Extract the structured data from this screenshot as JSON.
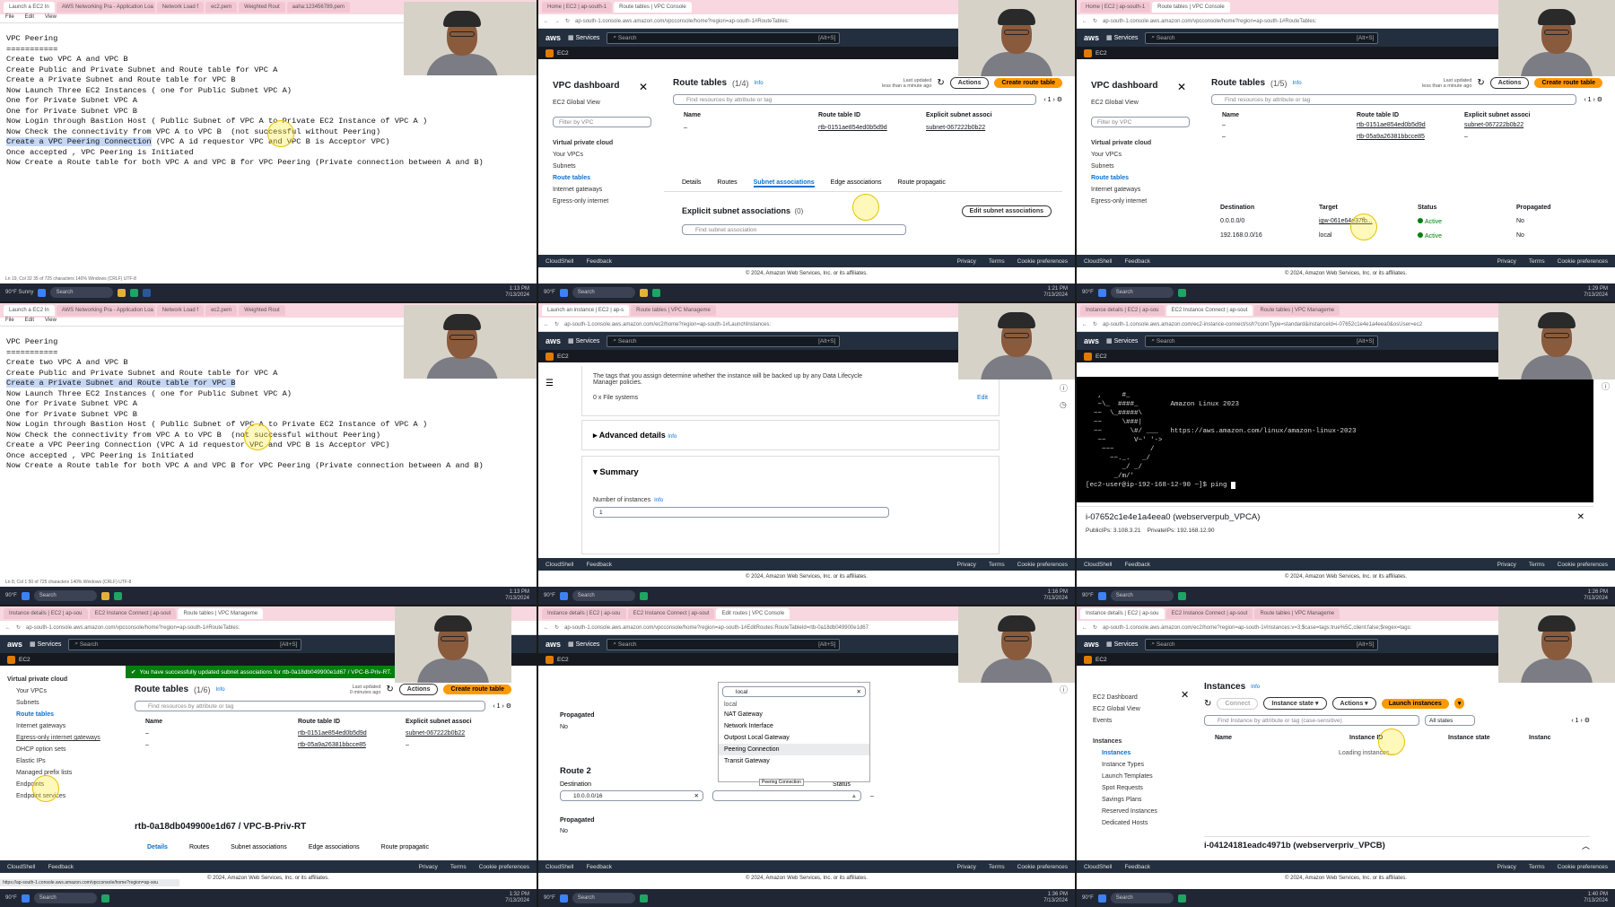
{
  "colors": {
    "aws_nav": "#232f3e",
    "aws_orange": "#ff9900",
    "aws_link": "#0972d3",
    "success": "#037f0c",
    "tab_bg": "#f8d7e0",
    "terminal": "#000000"
  },
  "common": {
    "aws_logo": "aws",
    "services": "Services",
    "search_placeholder": "Search",
    "search_shortcut": "[Alt+S]",
    "ec2": "EC2",
    "cloudshell": "CloudShell",
    "feedback": "Feedback",
    "copyright": "© 2024, Amazon Web Services, Inc. or its affiliates.",
    "privacy": "Privacy",
    "terms": "Terms",
    "cookie": "Cookie preferences",
    "temp": "90°F",
    "weather": "Sunny",
    "tb_search": "Search"
  },
  "p1": {
    "tabs": [
      "Launch a EC2 In",
      "AWS Networking Pra - Application Loa",
      "Network Load f",
      "ec2.pem",
      "Weighted Rout",
      "aaha:123456789.pem"
    ],
    "menu": [
      "File",
      "Edit",
      "View"
    ],
    "lines": [
      "VPC Peering",
      "===========",
      "",
      "Create two VPC A and VPC B",
      "",
      "Create Public and Private Subnet and Route table for VPC A",
      "",
      "Create a Private Subnet and Route table for VPC B",
      "",
      "Now Launch Three EC2 Instances ( one for Public Subnet VPC A)",
      "One for Private Subnet VPC A",
      "",
      "One for Private Subnet VPC B",
      "",
      "Now Login through Bastion Host ( Public Subnet of VPC A to Private EC2 Instance of VPC A )",
      "",
      "Now Check the connectivity from VPC A to VPC B  (not successful without Peering)",
      "",
      "Create a VPC Peering Connection (VPC A id requestor VPC and VPC B is Acceptor VPC)",
      "",
      "Once accepted , VPC Peering is Initiated",
      "",
      "Now Create a Route table for both VPC A and VPC B for VPC Peering (Private connection between A and B)"
    ],
    "highlight": "Create a VPC Peering Connection",
    "status": "Ln 19, Col 32    35 of 725 characters         140%    Windows (CRLF)    UTF-8",
    "time": "1:13 PM",
    "date": "7/13/2024"
  },
  "p2": {
    "tabs": [
      "Home | EC2 | ap-south-1",
      "Route tables | VPC Console"
    ],
    "url": "ap-south-1.console.aws.amazon.com/vpcconsole/home?region=ap-south-1#RouteTables:",
    "dash_title": "VPC dashboard",
    "global": "EC2 Global View",
    "filter": "Filter by VPC",
    "nav_head": "Virtual private cloud",
    "nav": [
      "Your VPCs",
      "Subnets",
      "Route tables",
      "Internet gateways",
      "Egress-only internet"
    ],
    "rt_title": "Route tables",
    "rt_count": "(1/4)",
    "info": "Info",
    "updated": "Last updated",
    "updated2": "less than a minute ago",
    "actions": "Actions",
    "create": "Create route table",
    "find": "Find resources by attribute or tag",
    "page": "1",
    "cols": [
      "Name",
      "Route table ID",
      "Explicit subnet associ"
    ],
    "row": [
      "–",
      "rtb-0151ae854ed0b5d9d",
      "subnet-067222b0b22"
    ],
    "dtabs": [
      "Details",
      "Routes",
      "Subnet associations",
      "Edge associations",
      "Route propagatic"
    ],
    "esa": "Explicit subnet associations",
    "esa_count": "(0)",
    "edit_btn": "Edit subnet associations",
    "find_sa": "Find subnet association",
    "time": "1:21 PM",
    "date": "7/13/2024"
  },
  "p3": {
    "tabs": [
      "Home | EC2 | ap-south-1",
      "Route tables | VPC Console"
    ],
    "url": "ap-south-1.console.aws.amazon.com/vpcconsole/home?region=ap-south-1#RouteTables:",
    "dash_title": "VPC dashboard",
    "global": "EC2 Global View",
    "filter": "Filter by VPC",
    "nav_head": "Virtual private cloud",
    "nav": [
      "Your VPCs",
      "Subnets",
      "Route tables",
      "Internet gateways",
      "Egress-only internet"
    ],
    "rt_title": "Route tables",
    "rt_count": "(1/5)",
    "info": "Info",
    "updated": "Last updated",
    "updated2": "less than a minute ago",
    "actions": "Actions",
    "create": "Create route table",
    "find": "Find resources by attribute or tag",
    "page": "1",
    "cols": [
      "Name",
      "Route table ID",
      "Explicit subnet associ"
    ],
    "rows": [
      [
        "–",
        "rtb-0151ae854ed0b5d9d",
        "subnet-067222b0b22"
      ],
      [
        "–",
        "rtb-05a9a26381bbcce85",
        "–"
      ]
    ],
    "rcols": [
      "Destination",
      "Target",
      "Status",
      "Propagated"
    ],
    "routes": [
      [
        "0.0.0.0/0",
        "igw-061e64e37fb...",
        "Active",
        "No"
      ],
      [
        "192.168.0.0/16",
        "local",
        "Active",
        "No"
      ]
    ],
    "time": "1:29 PM",
    "date": "7/13/2024"
  },
  "p4": {
    "tabs": [
      "Launch a EC2 In",
      "AWS Networking Pra - Application Loa",
      "Network Load f",
      "ec2.pem",
      "Weighted Rout"
    ],
    "menu": [
      "File",
      "Edit",
      "View"
    ],
    "lines": [
      "VPC Peering",
      "===========",
      "",
      "Create two VPC A and VPC B",
      "",
      "Create Public and Private Subnet and Route table for VPC A",
      "",
      "Create a Private Subnet and Route table for VPC B",
      "",
      "Now Launch Three EC2 Instances ( one for Public Subnet VPC A)",
      "One for Private Subnet VPC A",
      "",
      "One for Private Subnet VPC B",
      "",
      "Now Login through Bastion Host ( Public Subnet of VPC A to Private EC2 Instance of VPC A )",
      "",
      "Now Check the connectivity from VPC A to VPC B  (not successful without Peering)",
      "",
      "Create a VPC Peering Connection (VPC A id requestor VPC and VPC B is Acceptor VPC)",
      "",
      "Once accepted , VPC Peering is Initiated",
      "",
      "Now Create a Route table for both VPC A and VPC B for VPC Peering (Private connection between A and B)"
    ],
    "highlight": "Create a Private Subnet and Route table for VPC B",
    "status": "Ln 8, Col 1    50 of 725 characters         140%    Windows (CRLF)    UTF-8",
    "time": "1:13 PM",
    "date": "7/13/2024"
  },
  "p5": {
    "tabs": [
      "Launch an instance | EC2 | ap-s",
      "Route tables | VPC Manageme"
    ],
    "url": "ap-south-1.console.aws.amazon.com/ec2/home?region=ap-south-1#LaunchInstances:",
    "tags_text": "The tags that you assign determine whether the instance will be backed up by any Data Lifecycle Manager policies.",
    "fs": "0 x File systems",
    "edit": "Edit",
    "adv": "Advanced details",
    "info": "Info",
    "summary": "Summary",
    "num": "Number of instances",
    "num_val": "1",
    "time": "1:16 PM",
    "date": "7/13/2024"
  },
  "p6": {
    "tabs": [
      "Instance details | EC2 | ap-sou",
      "EC2 Instance Connect | ap-sout",
      "Route tables | VPC Manageme"
    ],
    "url": "ap-south-1.console.aws.amazon.com/ec2-instance-connect/ssh?connType=standard&instanceId=i-07652c1e4e1a4eea0&osUser=ec2",
    "term_banner": "Amazon Linux 2023",
    "term_url": "https://aws.amazon.com/linux/amazon-linux-2023",
    "prompt": "[ec2-user@ip-192-168-12-90 ~]$ ping ",
    "inst": "i-07652c1e4e1a4eea0 (webserverpub_VPCA)",
    "pub": "PublicIPs: 3.108.3.21",
    "priv": "PrivateIPs: 192.168.12.90",
    "time": "1:26 PM",
    "date": "7/13/2024"
  },
  "p7": {
    "tabs": [
      "Instance details | EC2 | ap-sou",
      "EC2 Instance Connect | ap-sout",
      "Route tables | VPC Manageme"
    ],
    "url": "ap-south-1.console.aws.amazon.com/vpcconsole/home?region=ap-south-1#RouteTables:",
    "nav_head": "Virtual private cloud",
    "nav": [
      "Your VPCs",
      "Subnets",
      "Route tables",
      "Internet gateways",
      "Egress-only internet gateways",
      "DHCP option sets",
      "Elastic IPs",
      "Managed prefix lists",
      "Endpoints",
      "Endpoint services"
    ],
    "flash": "You have successfully updated subnet associations for rtb-0a18db049900e1d67 / VPC-B-Priv-RT.",
    "rt_title": "Route tables",
    "rt_count": "(1/6)",
    "info": "Info",
    "updated": "Last updated",
    "updated2": "0 minutes ago",
    "actions": "Actions",
    "create": "Create route table",
    "find": "Find resources by attribute or tag",
    "page": "1",
    "cols": [
      "Name",
      "Route table ID",
      "Explicit subnet associ"
    ],
    "rows": [
      [
        "–",
        "rtb-0151ae854ed0b5d9d",
        "subnet-067222b0b22"
      ],
      [
        "–",
        "rtb-05a9a26381bbcce85",
        "–"
      ]
    ],
    "detail_title": "rtb-0a18db049900e1d67 / VPC-B-Priv-RT",
    "dtabs": [
      "Details",
      "Routes",
      "Subnet associations",
      "Edge associations",
      "Route propagatic"
    ],
    "status_url": "https://ap-south-1.console.aws.amazon.com/vpcconsole/home?region=ap-sou",
    "time": "1:32 PM",
    "date": "7/13/2024"
  },
  "p8": {
    "tabs": [
      "Instance details | EC2 | ap-sou",
      "EC2 Instance Connect | ap-sout",
      "Edit routes | VPC Console"
    ],
    "url": "ap-south-1.console.aws.amazon.com/vpcconsole/home?region=ap-south-1#EditRoutes:RouteTableId=rtb-0a18db049900e1d67",
    "propagated": "Propagated",
    "no": "No",
    "route2": "Route 2",
    "destination": "Destination",
    "dest_val": "10.0.0.0/16",
    "status": "Status",
    "dash": "–",
    "search_val": "local",
    "options": [
      "local",
      "NAT Gateway",
      "Network Interface",
      "Outpost Local Gateway",
      "Peering Connection",
      "Transit Gateway"
    ],
    "tooltip": "Peering Connection",
    "time": "1:36 PM",
    "date": "7/13/2024"
  },
  "p9": {
    "tabs": [
      "Instance details | EC2 | ap-sou",
      "EC2 Instance Connect | ap-sout",
      "Route tables | VPC Manageme"
    ],
    "url": "ap-south-1.console.aws.amazon.com/ec2/home?region=ap-south-1#Instances:v=3;$case=tags:true%5C,client:false;$regex=tags:",
    "nav": [
      "EC2 Dashboard",
      "EC2 Global View",
      "Events"
    ],
    "nav_head": "Instances",
    "nav2": [
      "Instances",
      "Instance Types",
      "Launch Templates",
      "Spot Requests",
      "Savings Plans",
      "Reserved Instances",
      "Dedicated Hosts"
    ],
    "title": "Instances",
    "info": "Info",
    "connect": "Connect",
    "state": "Instance state",
    "actions": "Actions",
    "launch": "Launch instances",
    "find": "Find Instance by attribute or tag (case-sensitive)",
    "all_states": "All states",
    "page": "1",
    "cols": [
      "Name",
      "Instance ID",
      "Instance state",
      "Instanc"
    ],
    "loading": "Loading instances...",
    "selected": "i-04124181eadc4971b (webserverpriv_VPCB)",
    "time": "1:40 PM",
    "date": "7/13/2024"
  }
}
